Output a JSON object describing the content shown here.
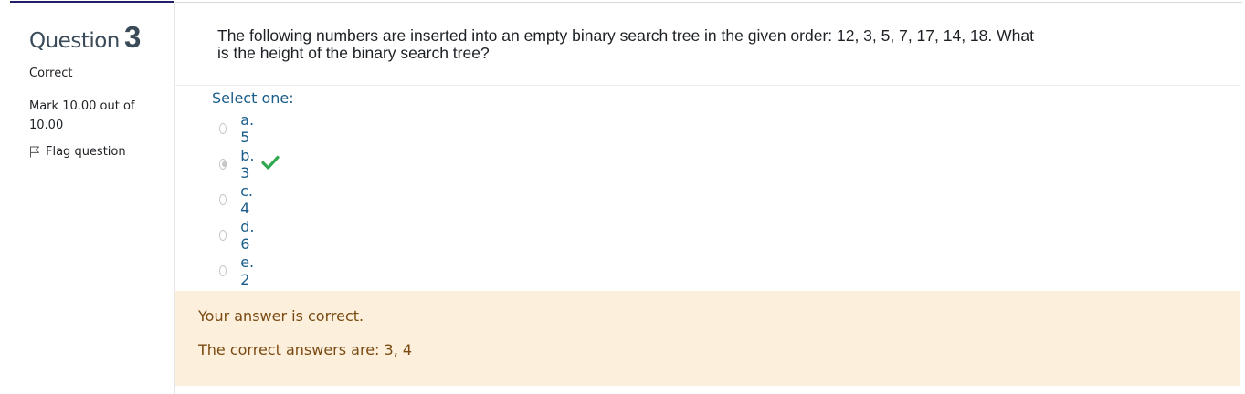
{
  "question": {
    "label_word": "Question",
    "number": "3",
    "state": "Correct",
    "grade": "Mark 10.00 out of 10.00",
    "flag_label": "Flag question",
    "text": "The following numbers are inserted into an empty binary search tree in the given order: 12, 3, 5, 7, 17, 14, 18. What is the height of the binary search tree?"
  },
  "answer": {
    "prompt": "Select one:",
    "options": [
      {
        "label": "a. 5",
        "selected": false,
        "correct": false
      },
      {
        "label": "b. 3",
        "selected": true,
        "correct": true
      },
      {
        "label": "c. 4",
        "selected": false,
        "correct": false
      },
      {
        "label": "d. 6",
        "selected": false,
        "correct": false
      },
      {
        "label": "e. 2",
        "selected": false,
        "correct": false
      }
    ]
  },
  "feedback": {
    "general": "Your answer is correct.",
    "right_answer": "The correct answers are: 3, 4"
  },
  "colors": {
    "link_blue": "#1a5d8a",
    "feedback_bg": "#fcefdc",
    "feedback_text": "#7a4a12",
    "check_green": "#2fa84f"
  }
}
